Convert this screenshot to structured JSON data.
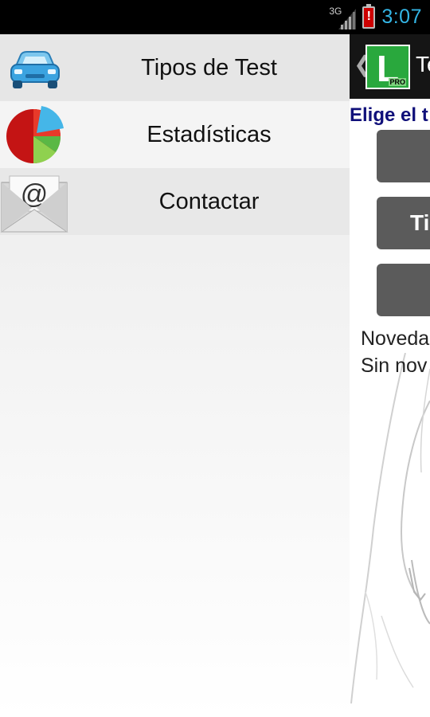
{
  "status_bar": {
    "network_label": "3G",
    "time": "3:07",
    "icons": [
      "signal-icon",
      "battery-alert-icon"
    ]
  },
  "drawer": {
    "items": [
      {
        "label": "Tipos de Test",
        "icon": "car-icon"
      },
      {
        "label": "Estadísticas",
        "icon": "pie-chart-icon"
      },
      {
        "label": "Contactar",
        "icon": "envelope-icon"
      }
    ]
  },
  "main": {
    "action_bar": {
      "title": "Te",
      "logo_text": "L",
      "logo_badge": "PRO"
    },
    "prompt": "Elige el t",
    "buttons": [
      {
        "label": ""
      },
      {
        "label": "Ti"
      },
      {
        "label": ""
      }
    ],
    "news_title": "Noveda",
    "news_text": "Sin nov"
  },
  "colors": {
    "status_bar_bg": "#000000",
    "clock": "#33b5e5",
    "action_bar_bg": "#151515",
    "prompt_text": "#10107a",
    "button_bg": "#5b5b5b",
    "logo_green": "#29a83d"
  }
}
